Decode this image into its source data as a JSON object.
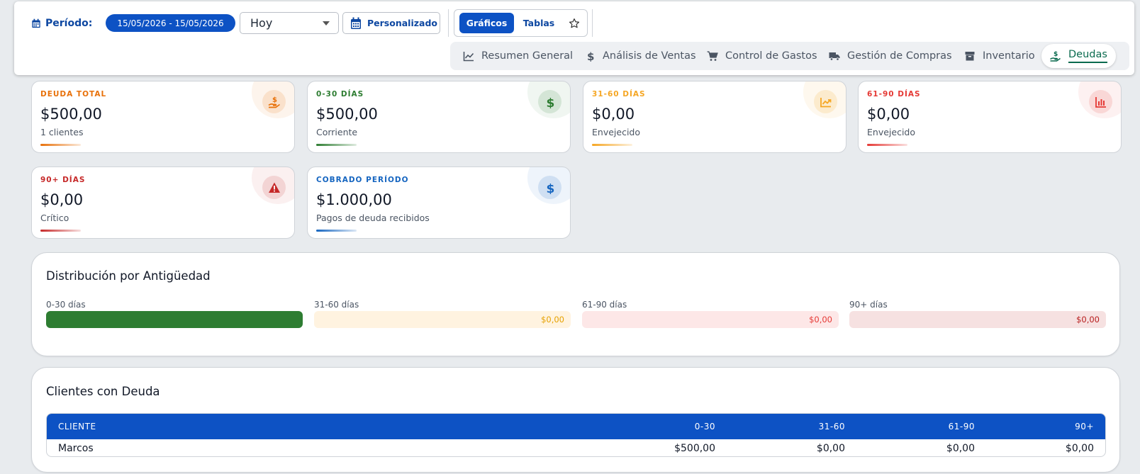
{
  "header": {
    "period_label": "Período:",
    "date_range": "15/05/2026 - 15/05/2026",
    "range_select": "Hoy",
    "custom_button": "Personalizado",
    "view_toggle": {
      "active": "Gráficos",
      "inactive": "Tablas"
    },
    "tabs": [
      {
        "label": "Resumen General",
        "icon": "line-chart-icon"
      },
      {
        "label": "Análisis de Ventas",
        "icon": "dollar-icon"
      },
      {
        "label": "Control de Gastos",
        "icon": "cart-icon"
      },
      {
        "label": "Gestión de Compras",
        "icon": "truck-icon"
      },
      {
        "label": "Inventario",
        "icon": "box-icon"
      },
      {
        "label": "Deudas",
        "icon": "hand-money-icon",
        "active": true
      }
    ]
  },
  "kpis": [
    {
      "label": "DEUDA TOTAL",
      "value": "$500,00",
      "sub": "1 clientes",
      "color": "#e8710a",
      "icon": "hand-money-icon"
    },
    {
      "label": "0-30 DÍAS",
      "value": "$500,00",
      "sub": "Corriente",
      "color": "#2e7d32",
      "icon": "dollar-icon"
    },
    {
      "label": "31-60 DÍAS",
      "value": "$0,00",
      "sub": "Envejecido",
      "color": "#f5a623",
      "icon": "trend-icon"
    },
    {
      "label": "61-90 DÍAS",
      "value": "$0,00",
      "sub": "Envejecido",
      "color": "#e53935",
      "icon": "bar-chart-icon"
    },
    {
      "label": "90+ DÍAS",
      "value": "$0,00",
      "sub": "Crítico",
      "color": "#c62828",
      "icon": "warning-icon"
    },
    {
      "label": "COBRADO PERÍODO",
      "value": "$1.000,00",
      "sub": "Pagos de deuda recibidos",
      "color": "#1565c0",
      "icon": "dollar-icon"
    }
  ],
  "aging": {
    "title": "Distribución por Antigüedad",
    "buckets": [
      {
        "label": "0-30 días",
        "value": "",
        "fill": 1.0,
        "color": "#2e7d32",
        "bg": "#2e7d32",
        "text_color": "#ffffff"
      },
      {
        "label": "31-60 días",
        "value": "$0,00",
        "fill": 0,
        "color": "#f5a623",
        "bg": "#fff3e0",
        "text_color": "#e6a100"
      },
      {
        "label": "61-90 días",
        "value": "$0,00",
        "fill": 0,
        "color": "#e53935",
        "bg": "#fde7e7",
        "text_color": "#e53935"
      },
      {
        "label": "90+ días",
        "value": "$0,00",
        "fill": 0,
        "color": "#c62828",
        "bg": "#f6e1e1",
        "text_color": "#b71c1c"
      }
    ]
  },
  "clients": {
    "title": "Clientes con Deuda",
    "columns": [
      "CLIENTE",
      "0-30",
      "31-60",
      "61-90",
      "90+"
    ],
    "rows": [
      {
        "cliente": "Marcos",
        "d0_30": "$500,00",
        "d31_60": "$0,00",
        "d61_90": "$0,00",
        "d90": "$0,00"
      }
    ]
  }
}
